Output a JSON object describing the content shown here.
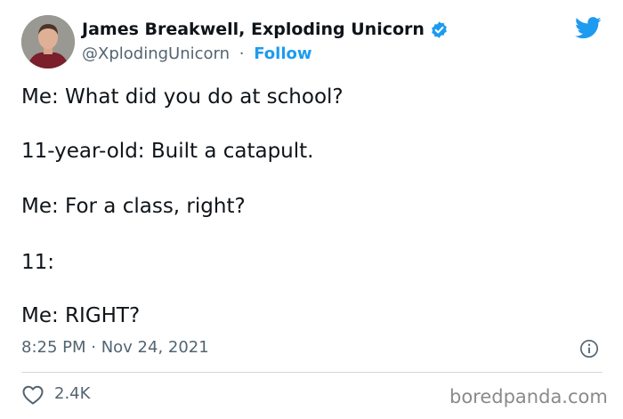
{
  "author": {
    "display_name": "James Breakwell, Exploding Unicorn",
    "handle": "@XplodingUnicorn",
    "separator": "·",
    "follow_label": "Follow",
    "verified": true
  },
  "tweet": {
    "lines": [
      "Me: What did you do at school?",
      "11-year-old: Built a catapult.",
      "Me: For a class, right?",
      "11:",
      "Me: RIGHT?"
    ],
    "timestamp": "8:25 PM · Nov 24, 2021",
    "likes": "2.4K"
  },
  "watermark": "boredpanda.com",
  "colors": {
    "twitter_blue": "#1d9bf0",
    "text": "#0f1419",
    "secondary_text": "#536471",
    "divider": "#cfd9de"
  },
  "icons": [
    "avatar",
    "verified-badge-icon",
    "twitter-bird-icon",
    "info-icon",
    "heart-icon"
  ]
}
